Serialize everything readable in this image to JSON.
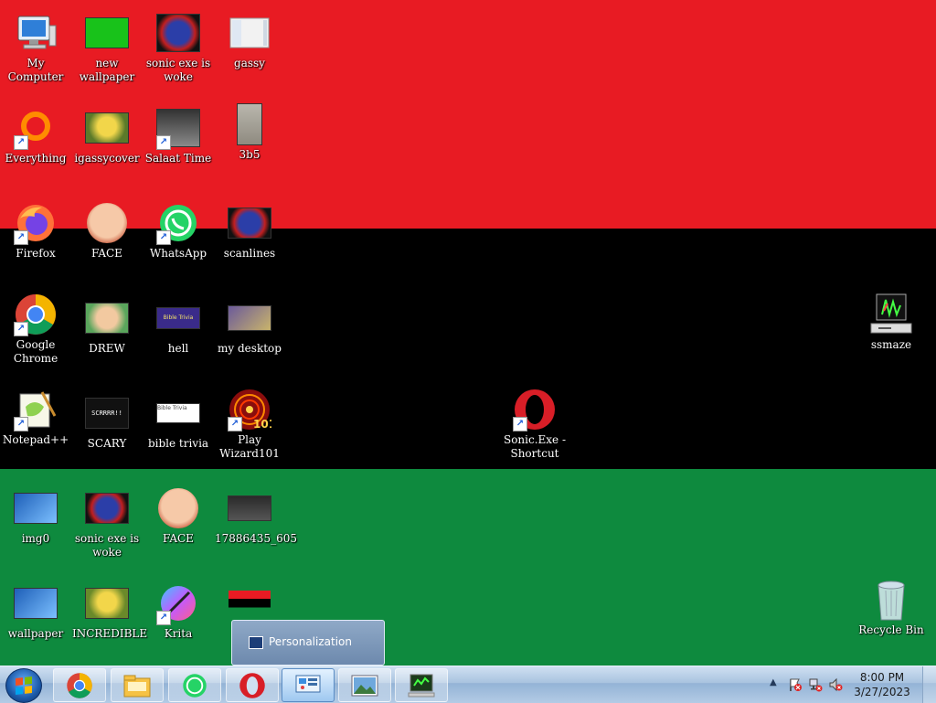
{
  "desktop": {
    "icons": [
      {
        "label": "My Computer"
      },
      {
        "label": "new wallpaper"
      },
      {
        "label": "sonic exe is woke"
      },
      {
        "label": "gassy"
      },
      {
        "label": "Everything"
      },
      {
        "label": "igassycover"
      },
      {
        "label": "Salaat Time"
      },
      {
        "label": "3b5"
      },
      {
        "label": "Firefox"
      },
      {
        "label": "FACE"
      },
      {
        "label": "WhatsApp"
      },
      {
        "label": "scanlines"
      },
      {
        "label": "Google Chrome"
      },
      {
        "label": "DREW"
      },
      {
        "label": "hell"
      },
      {
        "label": "my desktop"
      },
      {
        "label": "Notepad++"
      },
      {
        "label": "SCARY"
      },
      {
        "label": "bible trivia"
      },
      {
        "label": "Play Wizard101"
      },
      {
        "label": "Sonic.Exe - Shortcut"
      },
      {
        "label": "ssmaze"
      },
      {
        "label": "img0"
      },
      {
        "label": "sonic exe is woke"
      },
      {
        "label": "FACE"
      },
      {
        "label": "17886435_605"
      },
      {
        "label": "wallpaper"
      },
      {
        "label": "INCREDIBLE"
      },
      {
        "label": "Krita"
      },
      {
        "label": ""
      },
      {
        "label": "Recycle Bin"
      }
    ],
    "thumb_text": {
      "scary": "SCRRRR!!",
      "hell": "Bible Trivia MB!",
      "bible": "Bible Trivia"
    }
  },
  "popup": {
    "label": "Personalization"
  },
  "taskbar": {
    "items": [
      {
        "icon": "chrome-icon"
      },
      {
        "icon": "file-explorer-icon"
      },
      {
        "icon": "whatsapp-icon"
      },
      {
        "icon": "opera-icon"
      },
      {
        "icon": "personalization-icon"
      },
      {
        "icon": "picture-viewer-icon"
      },
      {
        "icon": "monitor-app-icon"
      }
    ]
  },
  "clock": {
    "time": "8:00 PM",
    "date": "3/27/2023"
  },
  "colors": {
    "flag_red": "#e81b23",
    "flag_black": "#000000",
    "flag_green": "#0e8a3e"
  }
}
